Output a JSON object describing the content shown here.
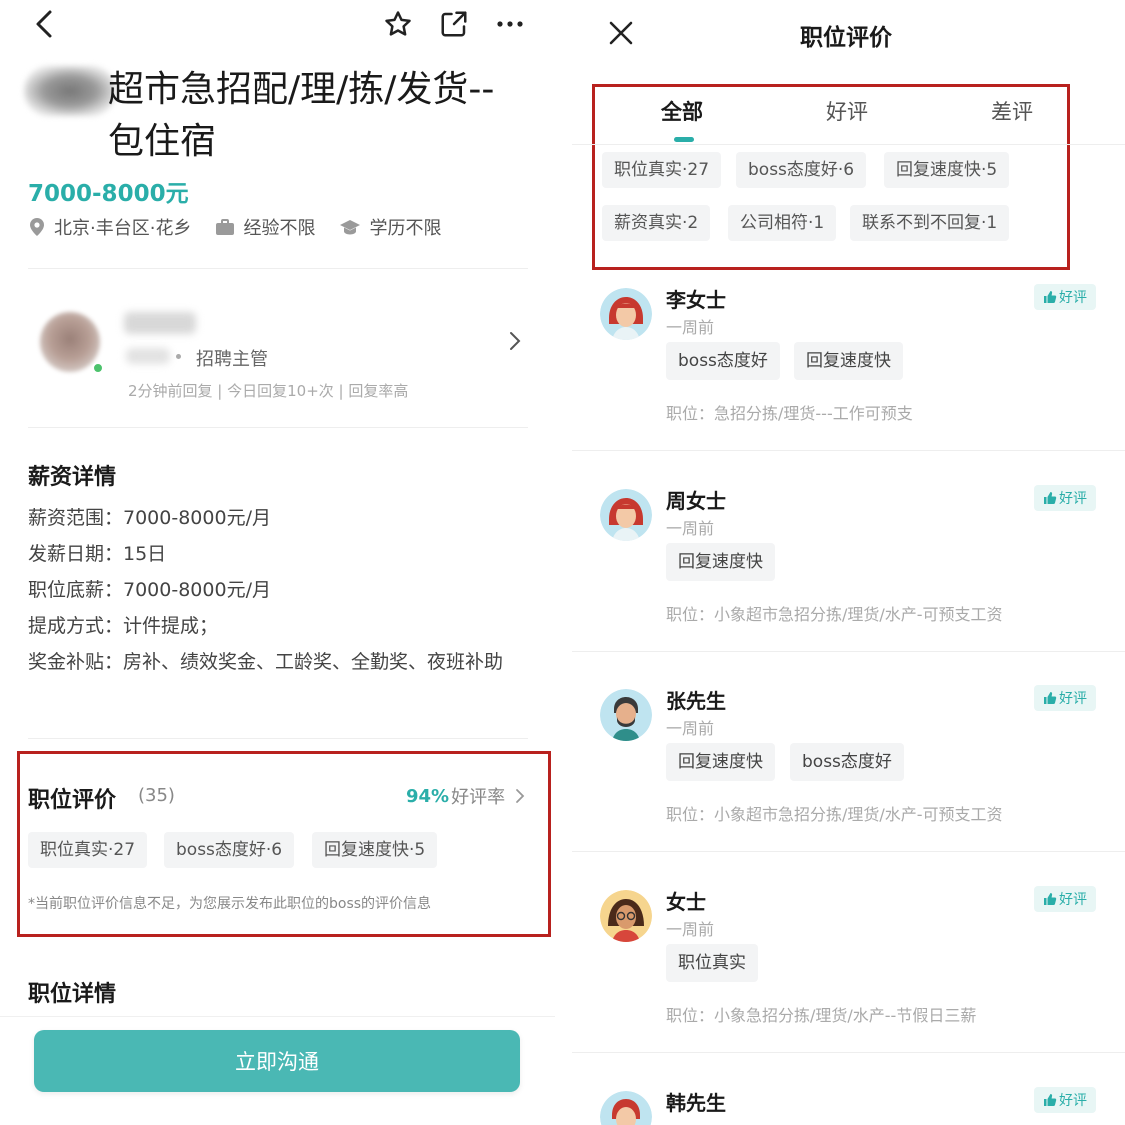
{
  "left": {
    "job_title": "超市急招配/理/拣/发货--包住宿",
    "salary": "7000-8000元",
    "meta": {
      "location": "北京·丰台区·花乡",
      "experience": "经验不限",
      "education": "学历不限"
    },
    "recruiter": {
      "role": "招聘主管",
      "reply_stats": "2分钟前回复 | 今日回复10+次 | 回复率高"
    },
    "salary_section": {
      "title": "薪资详情",
      "lines": [
        "薪资范围：7000-8000元/月",
        "发薪日期：15日",
        "职位底薪：7000-8000元/月",
        "提成方式：计件提成；",
        "奖金补贴：房补、绩效奖金、工龄奖、全勤奖、夜班补助"
      ]
    },
    "evaluation": {
      "title": "职位评价",
      "count": "(35)",
      "rate": "94%",
      "rate_label": "好评率",
      "chips": [
        "职位真实·27",
        "boss态度好·6",
        "回复速度快·5"
      ],
      "note": "*当前职位评价信息不足，为您展示发布此职位的boss的评价信息"
    },
    "job_detail_title": "职位详情",
    "chat_button": "立即沟通"
  },
  "right": {
    "title": "职位评价",
    "tabs": [
      "全部",
      "好评",
      "差评"
    ],
    "active_tab": 0,
    "tag_chips": [
      [
        "职位真实·27",
        "boss态度好·6",
        "回复速度快·5"
      ],
      [
        "薪资真实·2",
        "公司相符·1",
        "联系不到不回复·1"
      ]
    ],
    "reviews": [
      {
        "name": "李女士",
        "time": "一周前",
        "badge": "好评",
        "tags": [
          "boss态度好",
          "回复速度快"
        ],
        "position": "职位：急招分拣/理货---工作可预支",
        "avatar": "woman-red"
      },
      {
        "name": "周女士",
        "time": "一周前",
        "badge": "好评",
        "tags": [
          "回复速度快"
        ],
        "position": "职位：小象超市急招分拣/理货/水产-可预支工资",
        "avatar": "woman-red"
      },
      {
        "name": "张先生",
        "time": "一周前",
        "badge": "好评",
        "tags": [
          "回复速度快",
          "boss态度好"
        ],
        "position": "职位：小象超市急招分拣/理货/水产-可预支工资",
        "avatar": "man-beard"
      },
      {
        "name": "女士",
        "time": "一周前",
        "badge": "好评",
        "tags": [
          "职位真实"
        ],
        "position": "职位：小象急招分拣/理货/水产--节假日三薪",
        "avatar": "woman-glasses"
      },
      {
        "name": "韩先生",
        "time": "",
        "badge": "好评",
        "tags": [],
        "position": "",
        "avatar": "man-red"
      }
    ],
    "colors": {
      "accent": "#2aaea9",
      "highlight_border": "#b8211e",
      "chip_bg": "#f3f4f5",
      "button": "#4ab8b4"
    }
  }
}
